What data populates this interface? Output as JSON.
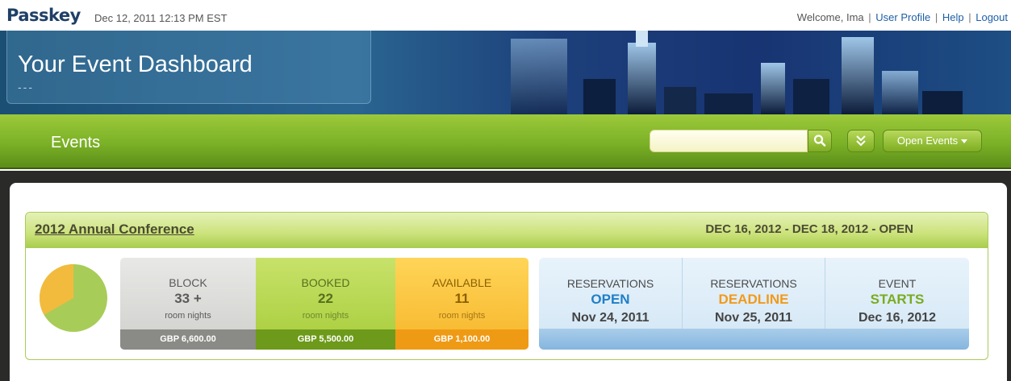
{
  "header": {
    "logo": "Passkey",
    "datetime": "Dec 12, 2011 12:13 PM EST",
    "welcome": "Welcome, Ima",
    "links": {
      "profile": "User Profile",
      "help": "Help",
      "logout": "Logout"
    },
    "separator": "|"
  },
  "banner": {
    "title": "Your Event Dashboard",
    "subtitle": "---"
  },
  "nav": {
    "title": "Events",
    "search": {
      "value": "",
      "placeholder": ""
    },
    "open_events_label": "Open Events"
  },
  "event": {
    "name": "2012 Annual Conference",
    "dates": "DEC 16, 2012 - DEC 18, 2012 -  OPEN",
    "pie": {
      "booked_fraction": 0.667,
      "available_fraction": 0.333,
      "colors": {
        "booked": "#a8cc58",
        "available": "#f2bb3e"
      }
    },
    "stats": {
      "block": {
        "label": "BLOCK",
        "value": "33 +",
        "unit": "room nights",
        "money": "GBP 6,600.00"
      },
      "booked": {
        "label": "BOOKED",
        "value": "22",
        "unit": "room nights",
        "money": "GBP 5,500.00"
      },
      "available": {
        "label": "AVAILABLE",
        "value": "11",
        "unit": "room nights",
        "money": "GBP 1,100.00"
      }
    },
    "reservations": [
      {
        "title": "RESERVATIONS",
        "status": "OPEN",
        "date": "Nov 24, 2011",
        "color": "#1f7fc8"
      },
      {
        "title": "RESERVATIONS",
        "status": "DEADLINE",
        "date": "Nov 25, 2011",
        "color": "#f29a1a"
      },
      {
        "title": "EVENT",
        "status": "STARTS",
        "date": "Dec 16, 2012",
        "color": "#7aab1f"
      }
    ]
  }
}
